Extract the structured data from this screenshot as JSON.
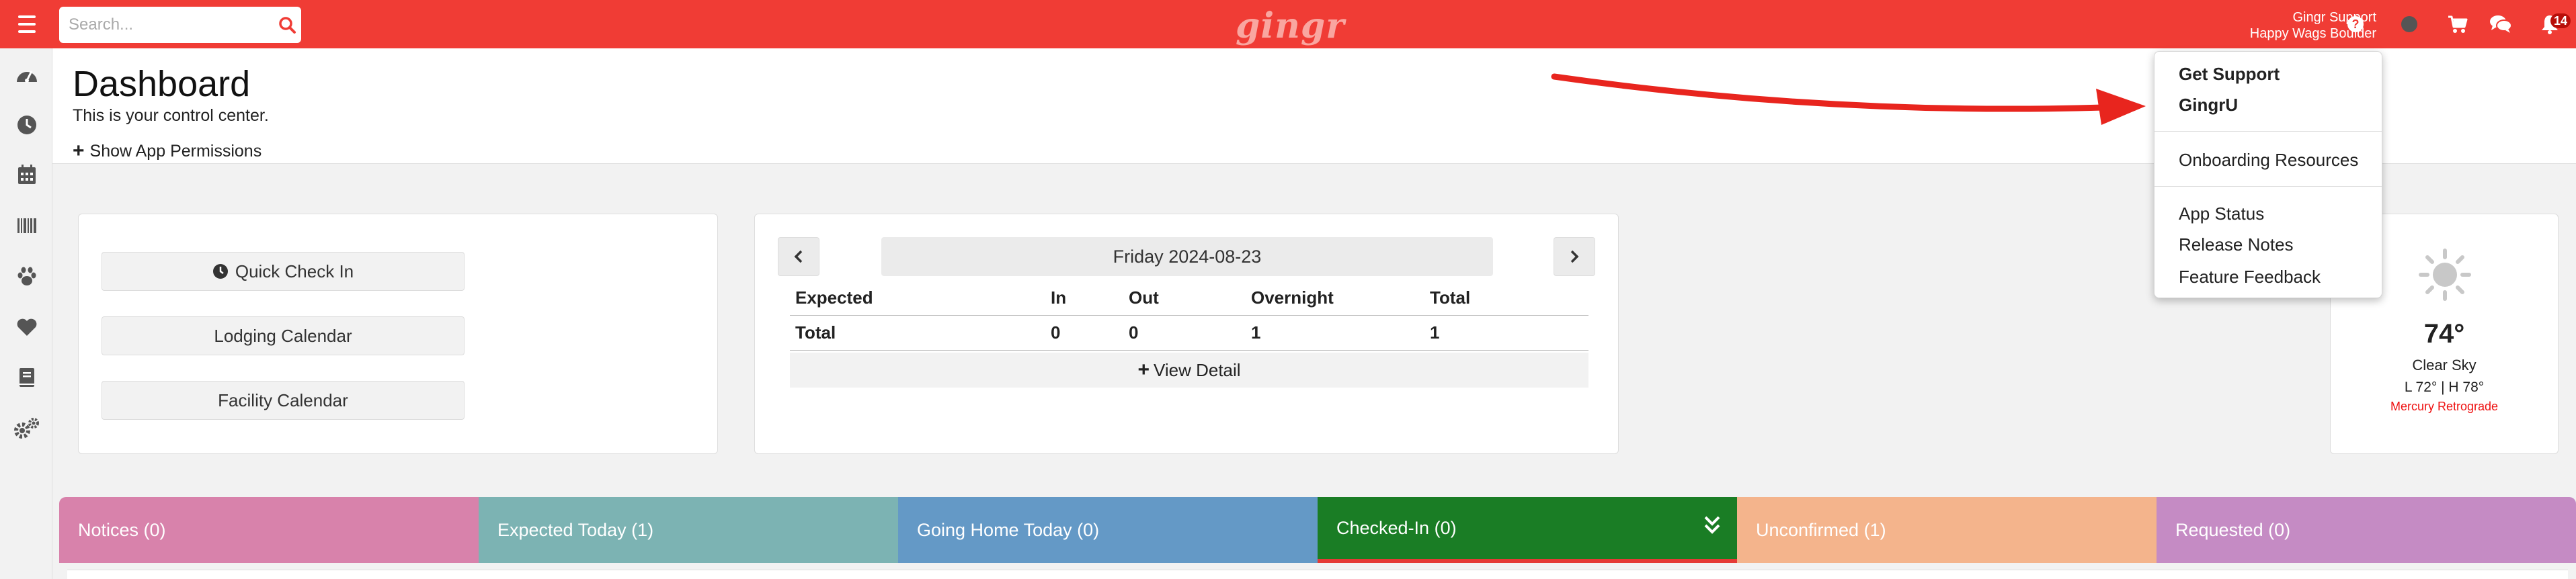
{
  "topbar": {
    "search_placeholder": "Search...",
    "logo": "gingr",
    "user_name": "Gingr Support",
    "location": "Happy Wags Boulder",
    "notification_count": "14",
    "colors": {
      "bar": "#f03c35"
    }
  },
  "sidebar": {
    "items": [
      "dashboard-icon",
      "clock-icon",
      "calendar-icon",
      "barcode-icon",
      "paw-icon",
      "heart-icon",
      "book-icon",
      "gears-icon"
    ]
  },
  "header": {
    "title": "Dashboard",
    "subtitle": "This is your control center.",
    "permissions_link": "Show App Permissions"
  },
  "quick_actions": {
    "check_in": "Quick Check In",
    "lodging_calendar": "Lodging Calendar",
    "facility_calendar": "Facility Calendar"
  },
  "summary": {
    "date": "Friday 2024-08-23",
    "columns": [
      "Expected",
      "In",
      "Out",
      "Overnight",
      "Total"
    ],
    "row": [
      "Total",
      "0",
      "0",
      "1",
      "1"
    ],
    "view_detail": "View Detail"
  },
  "weather": {
    "temp": "74°",
    "condition": "Clear Sky",
    "range": "L 72° | H 78°",
    "note": "Mercury Retrograde"
  },
  "tabs": [
    {
      "label": "Notices (0)",
      "color": "#d882ab"
    },
    {
      "label": "Expected Today (1)",
      "color": "#7cb3b3"
    },
    {
      "label": "Going Home Today (0)",
      "color": "#6499c6"
    },
    {
      "label": "Checked-In (0)",
      "color": "#1a7d25"
    },
    {
      "label": "Unconfirmed (1)",
      "color": "#f4b48c"
    },
    {
      "label": "Requested (0)",
      "color": "#c58bc4"
    }
  ],
  "dropdown": {
    "get_support": "Get Support",
    "gingru": "GingrU",
    "onboarding": "Onboarding Resources",
    "app_status": "App Status",
    "release_notes": "Release Notes",
    "feature_feedback": "Feature Feedback"
  }
}
